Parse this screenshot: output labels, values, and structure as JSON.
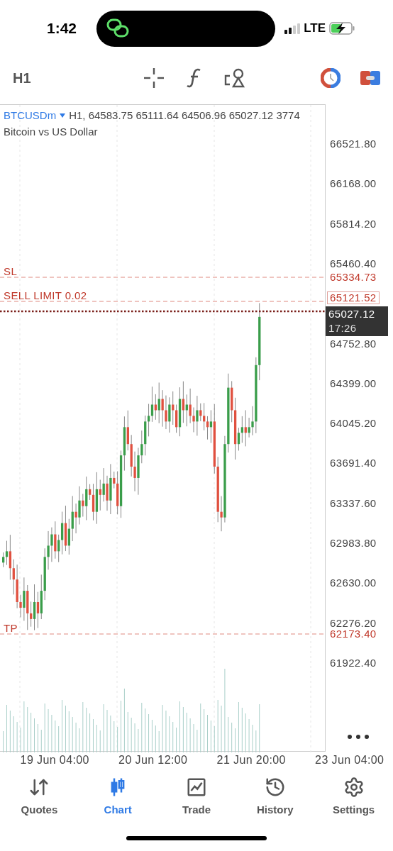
{
  "status_bar": {
    "time": "1:42",
    "network": "LTE"
  },
  "toolbar": {
    "timeframe": "H1"
  },
  "chart": {
    "symbol": "BTCUSDm",
    "info": "H1, 64583.75 65111.64 64506.96 65027.12 3774",
    "description": "Bitcoin vs US Dollar",
    "price_ticks": [
      "66521.80",
      "66168.00",
      "65814.20",
      "65460.40",
      "64752.80",
      "64399.00",
      "64045.20",
      "63691.40",
      "63337.60",
      "62983.80",
      "62630.00",
      "62276.20",
      "61922.40"
    ],
    "orders": [
      {
        "kind": "sl",
        "label": "SL",
        "price": "65334.73"
      },
      {
        "kind": "pending",
        "label": "SELL LIMIT 0.02",
        "price": "65121.52"
      },
      {
        "kind": "tp",
        "label": "TP",
        "price": "62173.40"
      }
    ],
    "current": {
      "price": "65027.12",
      "countdown": "17:26"
    },
    "time_ticks": [
      "19 Jun 04:00",
      "20 Jun 12:00",
      "21 Jun 20:00",
      "23 Jun 04:00"
    ]
  },
  "nav": [
    {
      "label": "Quotes",
      "selected": false
    },
    {
      "label": "Chart",
      "selected": true
    },
    {
      "label": "Trade",
      "selected": false
    },
    {
      "label": "History",
      "selected": false
    },
    {
      "label": "Settings",
      "selected": false
    }
  ]
}
